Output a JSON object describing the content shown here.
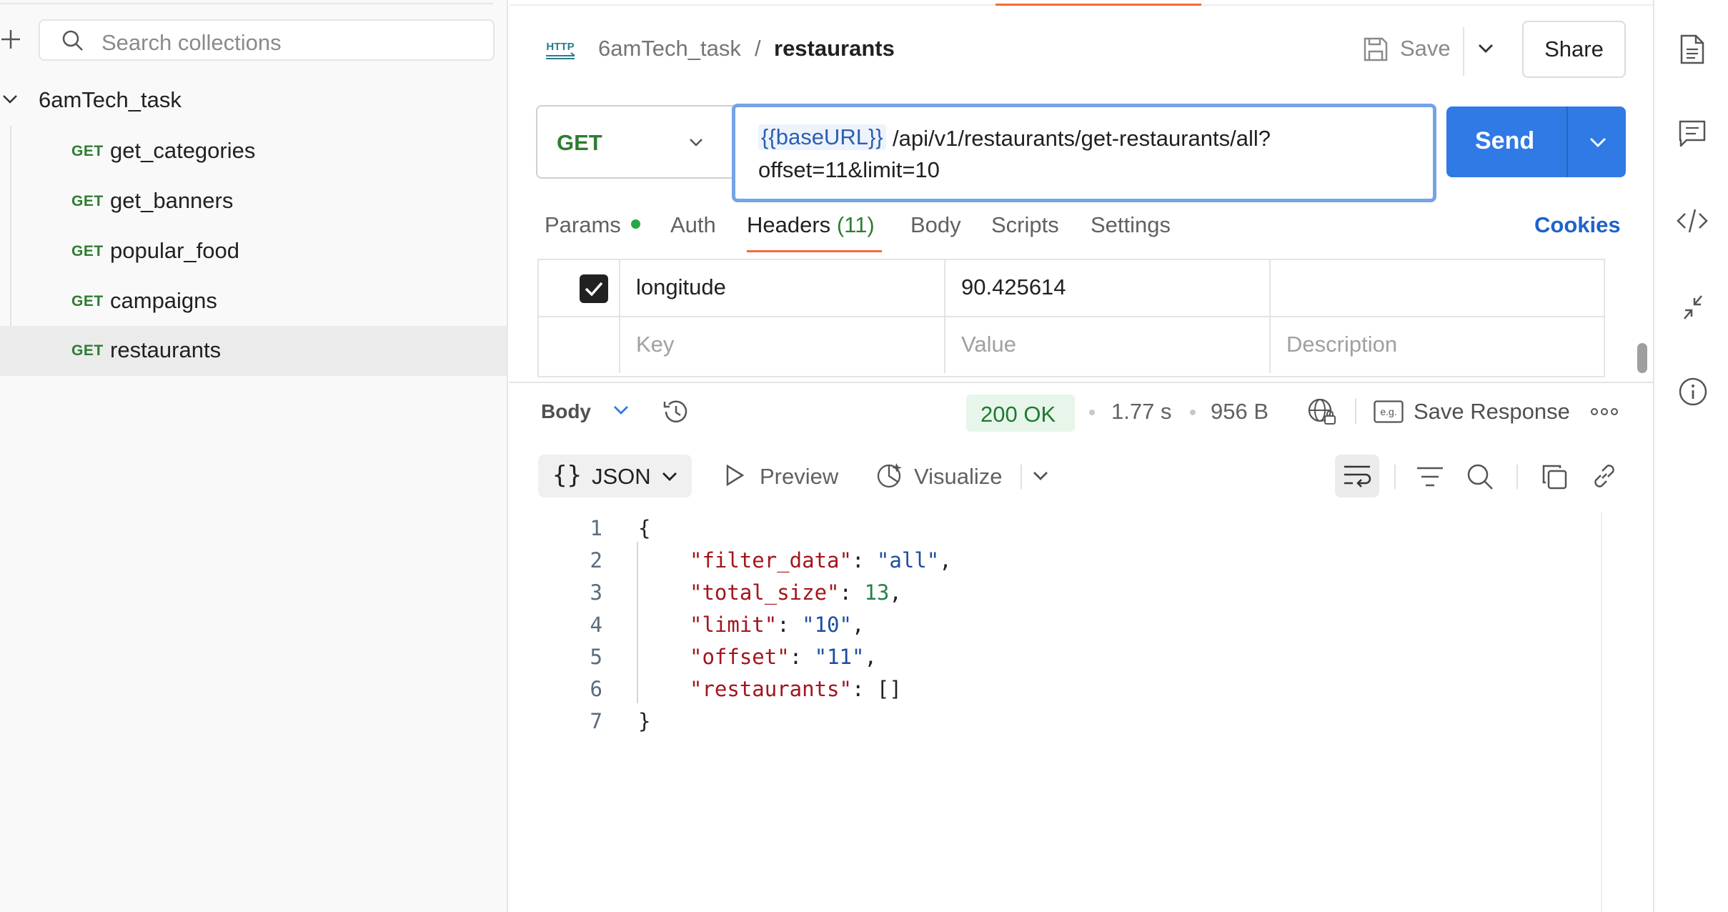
{
  "sidebar": {
    "search_placeholder": "Search collections",
    "collection_name": "6amTech_task",
    "requests": [
      {
        "method": "GET",
        "name": "get_categories"
      },
      {
        "method": "GET",
        "name": "get_banners"
      },
      {
        "method": "GET",
        "name": "popular_food"
      },
      {
        "method": "GET",
        "name": "campaigns"
      },
      {
        "method": "GET",
        "name": "restaurants",
        "active": true
      }
    ]
  },
  "header": {
    "type_badge": "HTTP",
    "breadcrumb_parent": "6amTech_task",
    "breadcrumb_separator": "/",
    "breadcrumb_current": "restaurants",
    "save_label": "Save",
    "share_label": "Share"
  },
  "request": {
    "method": "GET",
    "url_variable": "{{baseURL}}",
    "url_path": "/api/v1/restaurants/get-restaurants/all?",
    "url_query": "offset=11&limit=10",
    "send_label": "Send"
  },
  "tabs": {
    "params": "Params",
    "auth": "Auth",
    "headers": "Headers",
    "headers_count": "(11)",
    "body": "Body",
    "scripts": "Scripts",
    "settings": "Settings",
    "cookies": "Cookies"
  },
  "headers_table": {
    "row": {
      "key": "longitude",
      "value": "90.425614",
      "description": "",
      "checked": true
    },
    "placeholder": {
      "key": "Key",
      "value": "Value",
      "description": "Description"
    }
  },
  "response": {
    "body_label": "Body",
    "status": "200 OK",
    "time": "1.77 s",
    "size": "956 B",
    "save_response": "Save Response",
    "format": "JSON",
    "preview": "Preview",
    "visualize": "Visualize",
    "line_numbers": [
      "1",
      "2",
      "3",
      "4",
      "5",
      "6",
      "7"
    ],
    "json": {
      "open": "{",
      "close": "}",
      "entries": [
        {
          "key": "\"filter_data\"",
          "value": "\"all\"",
          "kind": "string"
        },
        {
          "key": "\"total_size\"",
          "value": "13",
          "kind": "number"
        },
        {
          "key": "\"limit\"",
          "value": "\"10\"",
          "kind": "string"
        },
        {
          "key": "\"offset\"",
          "value": "\"11\"",
          "kind": "string"
        },
        {
          "key": "\"restaurants\"",
          "value": "[]",
          "kind": "plain"
        }
      ]
    }
  },
  "colors": {
    "accent_orange": "#f26b3a",
    "send_blue": "#2f7ae5",
    "method_green": "#2e7d32",
    "status_green": "#1e7a32",
    "cookies_blue": "#1f63c9"
  },
  "icons": [
    "plus-icon",
    "search-icon",
    "chevron-down-icon",
    "http-icon",
    "save-icon",
    "history-icon",
    "globe-lock-icon",
    "example-icon",
    "more-icon",
    "play-icon",
    "visualize-icon",
    "wrap-icon",
    "filter-icon",
    "copy-icon",
    "link-icon",
    "document-icon",
    "comment-icon",
    "code-icon",
    "collapse-icon",
    "info-icon"
  ]
}
